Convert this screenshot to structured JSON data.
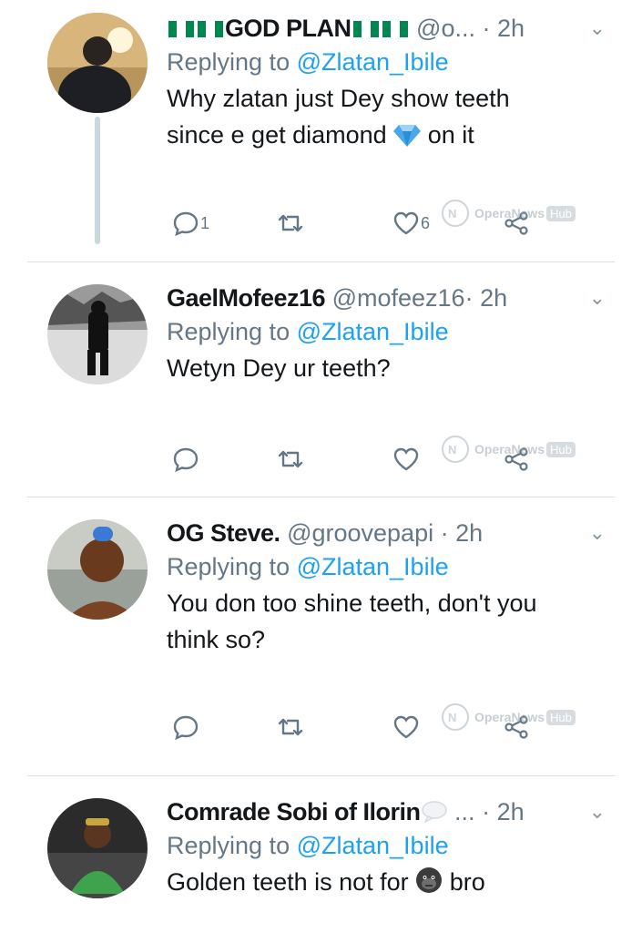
{
  "tweets": [
    {
      "name": "GOD PLAN",
      "handle": "@o...",
      "sep": "·",
      "time": "2h",
      "replying_prefix": "Replying to ",
      "replying_to": "@Zlatan_Ibile",
      "text_lines": [
        "Why zlatan just Dey show teeth",
        "since e get diamond",
        "on it"
      ],
      "reply_count": "1",
      "like_count": "6"
    },
    {
      "name": "GaelMofeez16",
      "handle": "@mofeez16",
      "sep": "·",
      "time": "2h",
      "replying_prefix": "Replying to ",
      "replying_to": "@Zlatan_Ibile",
      "text_lines": [
        "Wetyn Dey ur teeth?"
      ],
      "reply_count": "",
      "like_count": ""
    },
    {
      "name": "OG Steve.",
      "handle": "@groovepapi",
      "sep": "·",
      "time": "2h",
      "replying_prefix": "Replying to ",
      "replying_to": "@Zlatan_Ibile",
      "text_lines": [
        "You don too shine teeth, don't you",
        "think so?"
      ],
      "reply_count": "",
      "like_count": ""
    },
    {
      "name": "Comrade Sobi of Ilorin",
      "handle": "...",
      "sep": "·",
      "time": "2h",
      "replying_prefix": "Replying to ",
      "replying_to": "@Zlatan_Ibile",
      "text_lines": [
        "Golden teeth is not for",
        "bro"
      ],
      "reply_count": "",
      "like_count": ""
    }
  ],
  "watermark": {
    "brand": "OperaNews",
    "hub": "Hub"
  },
  "colors": {
    "link": "#1da1f2",
    "muted": "#657786",
    "flag_green": "#008751"
  },
  "icons": [
    "reply-icon",
    "retweet-icon",
    "like-icon",
    "share-icon",
    "chevron-down-icon",
    "diamond-emoji",
    "gorilla-emoji",
    "nigeria-flag"
  ]
}
